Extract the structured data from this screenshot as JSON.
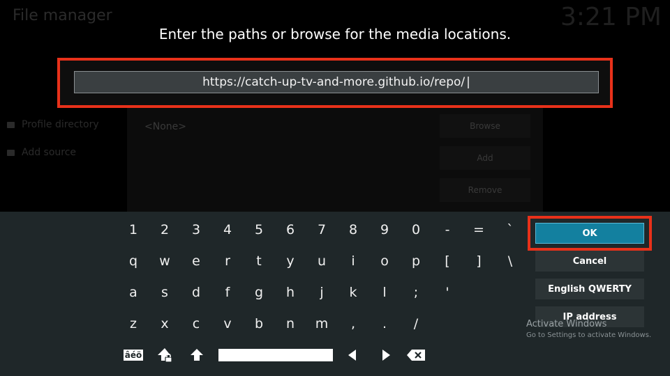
{
  "background": {
    "title": "File manager",
    "clock": "3:21 PM",
    "side_items": [
      "Profile directory",
      "Add source"
    ],
    "list_value": "<None>",
    "buttons": [
      "Browse",
      "Add",
      "Remove"
    ]
  },
  "prompt": "Enter the paths or browse for the media locations.",
  "url_field": {
    "value": "https://catch-up-tv-and-more.github.io/repo/",
    "caret": "|"
  },
  "keyboard": {
    "rows": [
      [
        "1",
        "2",
        "3",
        "4",
        "5",
        "6",
        "7",
        "8",
        "9",
        "0",
        "-",
        "=",
        "`"
      ],
      [
        "q",
        "w",
        "e",
        "r",
        "t",
        "y",
        "u",
        "i",
        "o",
        "p",
        "[",
        "]",
        "\\"
      ],
      [
        "a",
        "s",
        "d",
        "f",
        "g",
        "h",
        "j",
        "k",
        "l",
        ";",
        "'"
      ],
      [
        "z",
        "x",
        "c",
        "v",
        "b",
        "n",
        "m",
        ",",
        ".",
        "/"
      ]
    ],
    "accent_label": "âéö",
    "icons": [
      "shift-lock-icon",
      "shift-icon",
      "space-bar",
      "arrow-left-icon",
      "arrow-right-icon",
      "backspace-icon"
    ]
  },
  "side_buttons": {
    "ok": "OK",
    "cancel": "Cancel",
    "layout": "English QWERTY",
    "ip": "IP address"
  },
  "watermark": {
    "line1": "Activate Windows",
    "line2": "Go to Settings to activate Windows."
  },
  "colors": {
    "highlight": "#e8311a",
    "ok_bg": "#13809f",
    "panel_bg": "#1f2729"
  }
}
